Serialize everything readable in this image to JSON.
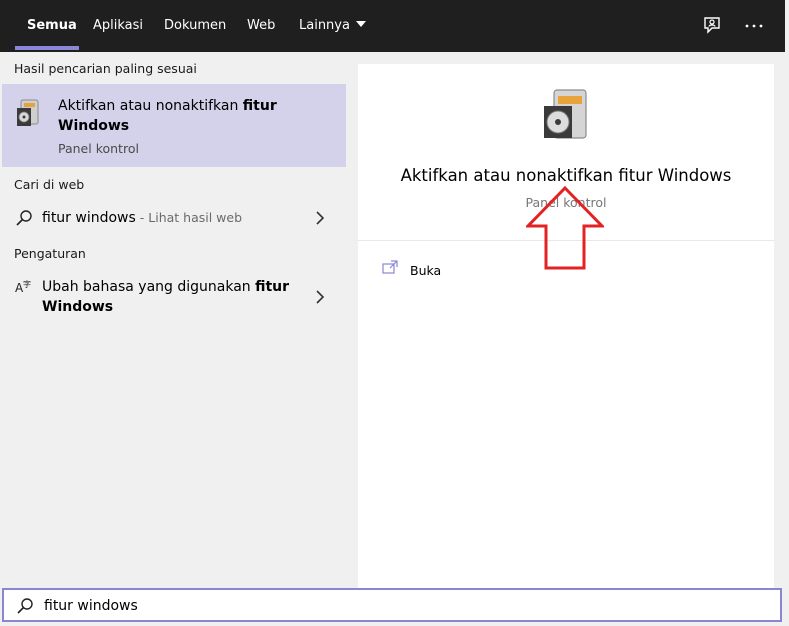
{
  "tabs": [
    {
      "label": "Semua"
    },
    {
      "label": "Aplikasi"
    },
    {
      "label": "Dokumen"
    },
    {
      "label": "Web"
    },
    {
      "label": "Lainnya"
    }
  ],
  "icons": {
    "feedback": "feedback-icon",
    "more": "more-options-icon",
    "app": "control-panel-app-icon",
    "search": "search-icon",
    "language": "language-settings-icon",
    "open": "open-icon",
    "chevron": "chevron-right-icon"
  },
  "left": {
    "best_match_header": "Hasil pencarian paling sesuai",
    "best_match": {
      "title_normal": "Aktifkan atau nonaktifkan ",
      "title_bold1": "fitur",
      "title_bold2": "Windows",
      "subtitle": "Panel kontrol"
    },
    "web_header": "Cari di web",
    "web_item": {
      "query": "fitur windows",
      "hint": " - Lihat hasil web"
    },
    "settings_header": "Pengaturan",
    "settings_item": {
      "text_normal": "Ubah bahasa yang digunakan ",
      "text_bold1": "fitur",
      "text_bold2": "Windows"
    }
  },
  "detail": {
    "title": "Aktifkan atau nonaktifkan fitur Windows",
    "subtitle": "Panel kontrol",
    "actions": [
      {
        "label": "Buka"
      }
    ]
  },
  "search": {
    "value": "fitur windows"
  },
  "colors": {
    "topbar": "#1f1f1f",
    "accent": "#8b86d8",
    "selection": "#d4d2ea",
    "arrow": "#e32222"
  }
}
